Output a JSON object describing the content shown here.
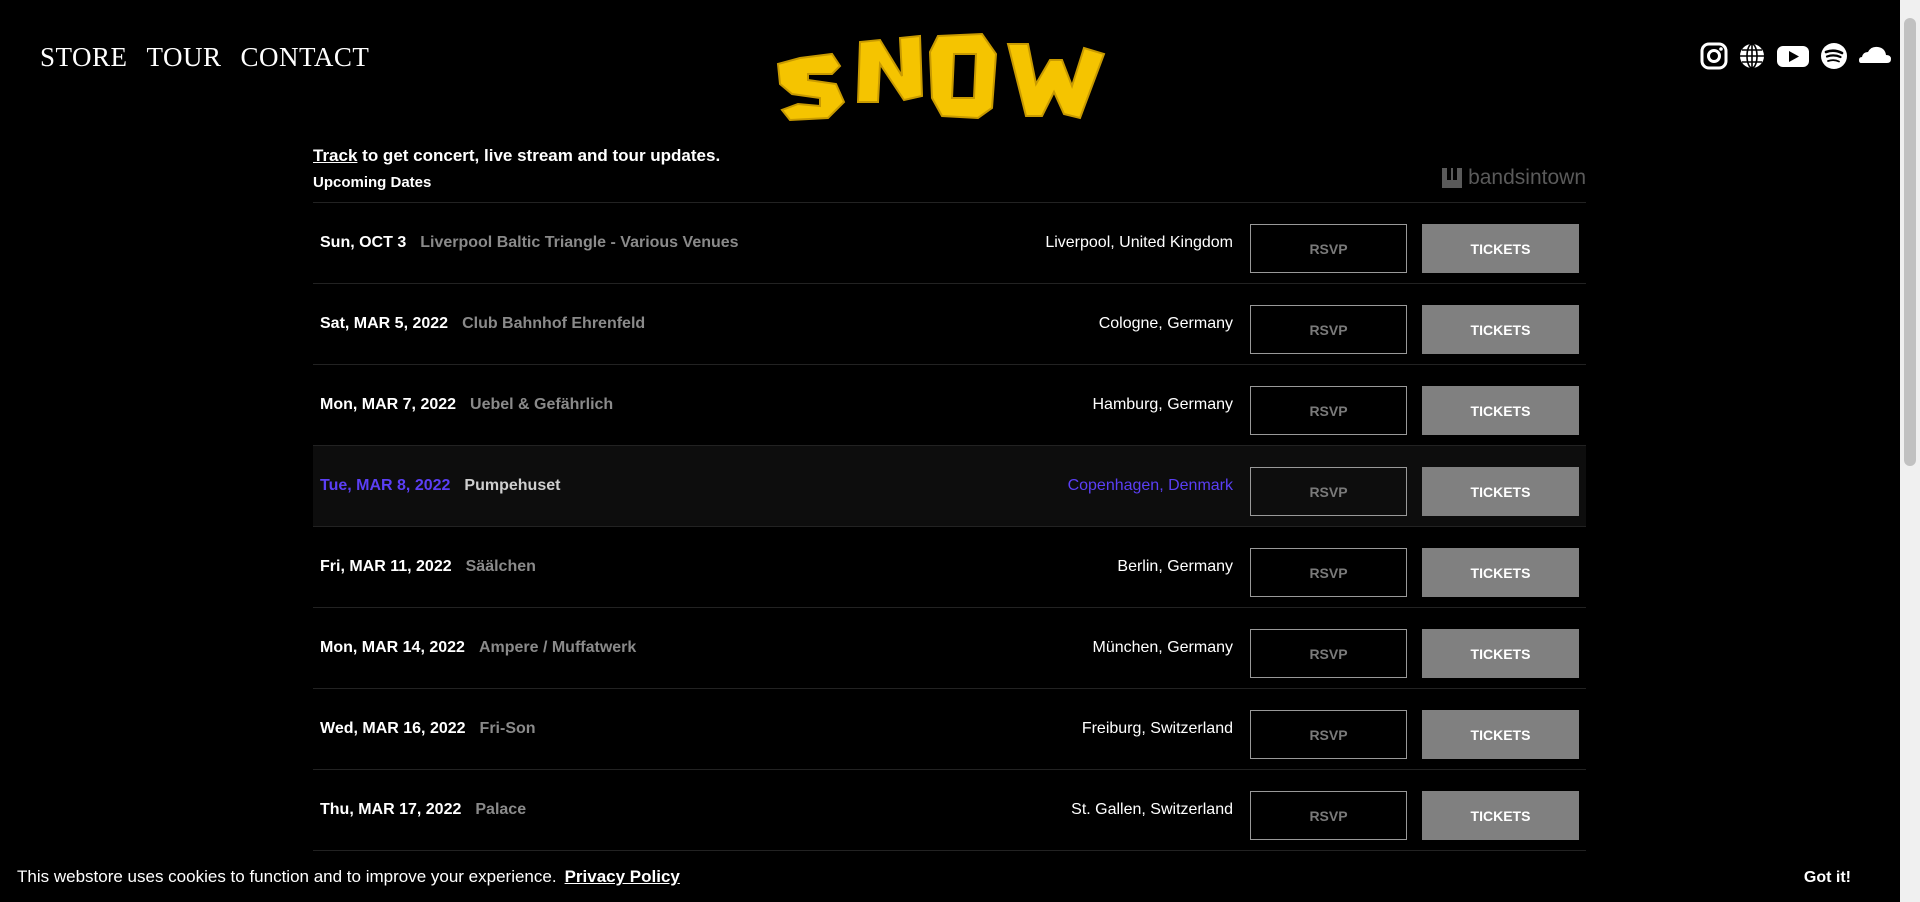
{
  "nav": {
    "items": [
      "STORE",
      "TOUR",
      "CONTACT"
    ]
  },
  "logo": {
    "text": "SNOW",
    "color": "#f5c400"
  },
  "social": {
    "icons": [
      "instagram-icon",
      "globe-icon",
      "youtube-icon",
      "spotify-icon",
      "soundcloud-icon"
    ]
  },
  "widget": {
    "track_link": "Track",
    "track_rest": " to get concert, live stream and tour updates.",
    "upcoming": "Upcoming Dates",
    "brand": "bandsintown"
  },
  "events": [
    {
      "date": "Sun, OCT 3",
      "venue": "Liverpool Baltic Triangle - Various Venues",
      "location": "Liverpool, United Kingdom",
      "rsvp": "RSVP",
      "tickets": "TICKETS"
    },
    {
      "date": "Sat, MAR 5, 2022",
      "venue": "Club Bahnhof Ehrenfeld",
      "location": "Cologne, Germany",
      "rsvp": "RSVP",
      "tickets": "TICKETS"
    },
    {
      "date": "Mon, MAR 7, 2022",
      "venue": "Uebel & Gefährlich",
      "location": "Hamburg, Germany",
      "rsvp": "RSVP",
      "tickets": "TICKETS"
    },
    {
      "date": "Tue, MAR 8, 2022",
      "venue": "Pumpehuset",
      "location": "Copenhagen, Denmark",
      "rsvp": "RSVP",
      "tickets": "TICKETS"
    },
    {
      "date": "Fri, MAR 11, 2022",
      "venue": "Säälchen",
      "location": "Berlin, Germany",
      "rsvp": "RSVP",
      "tickets": "TICKETS"
    },
    {
      "date": "Mon, MAR 14, 2022",
      "venue": "Ampere / Muffatwerk",
      "location": "München, Germany",
      "rsvp": "RSVP",
      "tickets": "TICKETS"
    },
    {
      "date": "Wed, MAR 16, 2022",
      "venue": "Fri-Son",
      "location": "Freiburg, Switzerland",
      "rsvp": "RSVP",
      "tickets": "TICKETS"
    },
    {
      "date": "Thu, MAR 17, 2022",
      "venue": "Palace",
      "location": "St. Gallen, Switzerland",
      "rsvp": "RSVP",
      "tickets": "TICKETS"
    }
  ],
  "cookie": {
    "message": "This webstore uses cookies to function and to improve your experience.",
    "policy_link": "Privacy Policy",
    "accept": "Got it!"
  },
  "colors": {
    "accent": "#5b3ff5",
    "button_gray": "#808080",
    "background": "#000000"
  }
}
